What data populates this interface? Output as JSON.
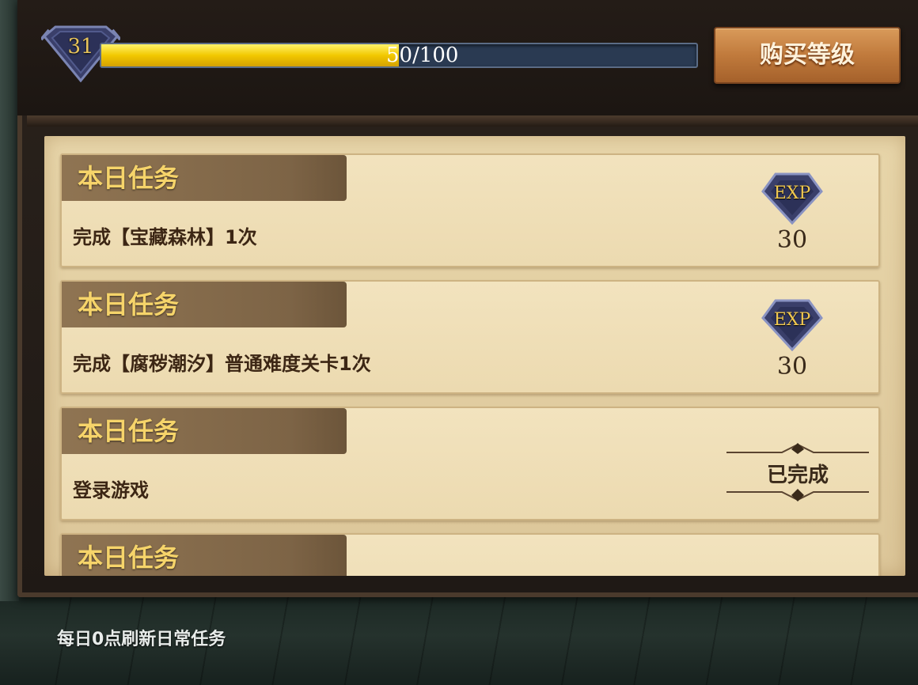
{
  "header": {
    "level": "31",
    "xp_text": "50/100",
    "xp_progress": 0.5,
    "buy_level_label": "购买等级"
  },
  "tasks": [
    {
      "tag": "本日任务",
      "description": "完成【宝藏森林】1次",
      "reward_icon": "EXP",
      "reward_amount": "30",
      "completed": false
    },
    {
      "tag": "本日任务",
      "description": "完成【腐秽潮汐】普通难度关卡1次",
      "reward_icon": "EXP",
      "reward_amount": "30",
      "completed": false
    },
    {
      "tag": "本日任务",
      "description": "登录游戏",
      "status_label": "已完成",
      "completed": true
    },
    {
      "tag": "本日任务"
    }
  ],
  "footer": {
    "note": "每日0点刷新日常任务"
  },
  "colors": {
    "xp_fill": "#f2c800",
    "tag_text": "#f6d46a",
    "button": "#c07a3c"
  }
}
